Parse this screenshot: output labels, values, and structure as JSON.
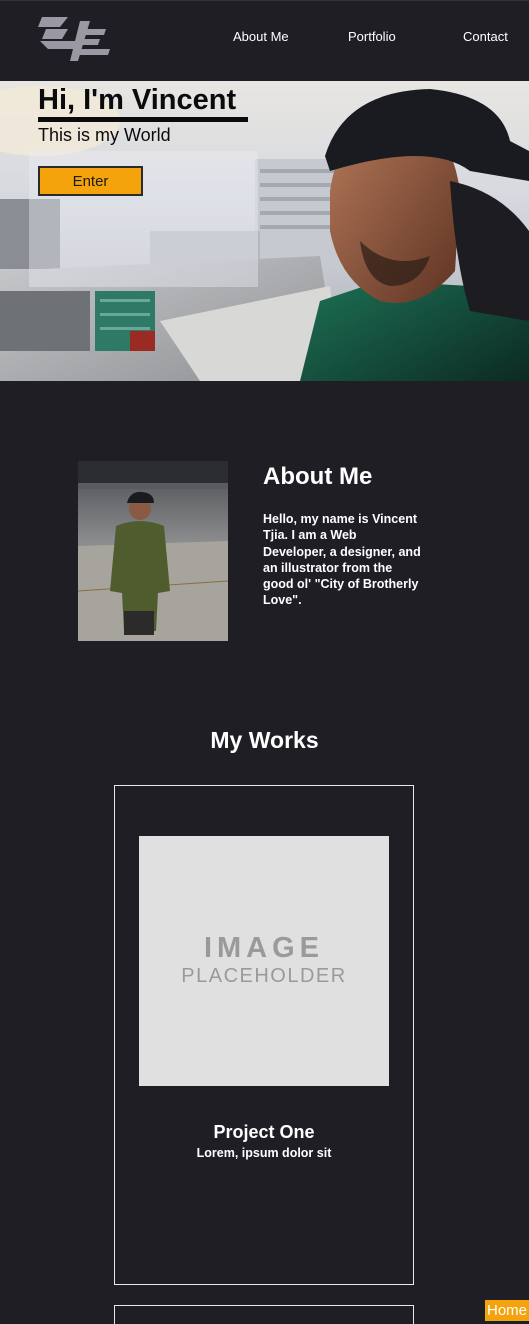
{
  "nav": {
    "logo_icon": "vt-monogram-logo",
    "links": [
      "About Me",
      "Portfolio",
      "Contact"
    ]
  },
  "hero": {
    "title": "Hi, I'm Vincent",
    "subtitle": "This is my World",
    "enter_label": "Enter",
    "background_icon": "hero-portrait-photo"
  },
  "about": {
    "heading": "About Me",
    "text": "Hello, my name is Vincent Tjia. I am a Web Developer, a designer, and an illustrator from the good ol' \"City of Brotherly Love\".",
    "photo_icon": "about-portrait-photo"
  },
  "works": {
    "heading": "My Works",
    "projects": [
      {
        "placeholder_line1": "IMAGE",
        "placeholder_line2": "PLACEHOLDER",
        "title": "Project One",
        "description": "Lorem, ipsum dolor sit"
      }
    ]
  },
  "home_label": "Home",
  "colors": {
    "background": "#1e1e24",
    "accent": "#f5a30d",
    "text": "#ffffff"
  }
}
